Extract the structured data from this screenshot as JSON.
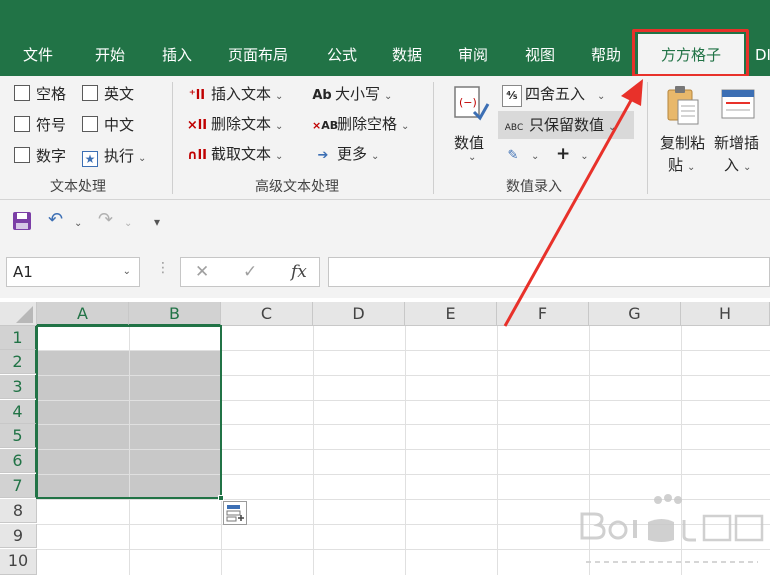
{
  "tabs": {
    "file": "文件",
    "home": "开始",
    "insert": "插入",
    "page_layout": "页面布局",
    "formulas": "公式",
    "data": "数据",
    "review": "审阅",
    "view": "视图",
    "help": "帮助",
    "active": "方方格子",
    "partial": "DI"
  },
  "ribbon": {
    "text_group": {
      "label": "文本处理",
      "space": "空格",
      "english": "英文",
      "symbol": "符号",
      "chinese": "中文",
      "number": "数字",
      "execute": "执行"
    },
    "advanced_group": {
      "label": "高级文本处理",
      "insert_text": "插入文本",
      "delete_text": "删除文本",
      "extract_text": "截取文本",
      "case": "大小写",
      "delete_space": "删除空格",
      "more": "更多"
    },
    "numeric_group": {
      "label": "数值录入",
      "value": "数值",
      "round": "四舍五入",
      "keep_value": "只保留数值"
    },
    "paste_group": {
      "copy_paste_1": "复制粘",
      "copy_paste_2": "贴",
      "new_insert_1": "新增插",
      "new_insert_2": "入"
    }
  },
  "formula_bar": {
    "name_box": "A1",
    "fx": "fx"
  },
  "sheet": {
    "columns": [
      "A",
      "B",
      "C",
      "D",
      "E",
      "F",
      "G",
      "H"
    ],
    "rows": [
      "1",
      "2",
      "3",
      "4",
      "5",
      "6",
      "7",
      "8",
      "9",
      "10"
    ]
  },
  "colors": {
    "accent": "#217346",
    "highlight": "#e8312a"
  }
}
